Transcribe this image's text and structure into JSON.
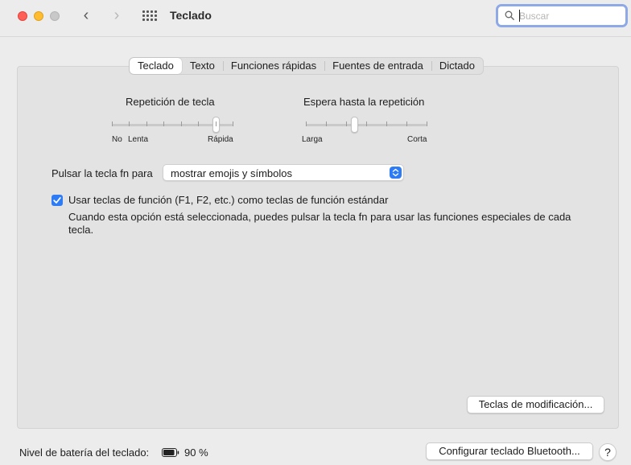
{
  "window": {
    "title": "Teclado",
    "search_placeholder": "Buscar"
  },
  "tabs": [
    {
      "label": "Teclado",
      "active": true
    },
    {
      "label": "Texto",
      "active": false
    },
    {
      "label": "Funciones rápidas",
      "active": false
    },
    {
      "label": "Fuentes de entrada",
      "active": false
    },
    {
      "label": "Dictado",
      "active": false
    }
  ],
  "key_repeat": {
    "label": "Repetición de tecla",
    "min_label": "No",
    "min2_label": "Lenta",
    "max_label": "Rápida",
    "level": 0.857
  },
  "repeat_delay": {
    "label": "Espera hasta la repetición",
    "min_label": "Larga",
    "max_label": "Corta",
    "level": 0.4
  },
  "fn_key": {
    "label": "Pulsar la tecla fn para",
    "selected": "mostrar emojis y símbolos"
  },
  "function_keys_checkbox": {
    "label": "Usar teclas de función (F1, F2, etc.) como teclas de función estándar",
    "checked": true,
    "description": "Cuando esta opción está seleccionada, puedes pulsar la tecla fn para usar las funciones especiales de cada tecla."
  },
  "buttons": {
    "modifier_keys": "Teclas de modificación...",
    "bluetooth": "Configurar teclado Bluetooth...",
    "help": "?"
  },
  "battery": {
    "label": "Nivel de batería del teclado:",
    "value": "90 %",
    "level": 0.9
  },
  "colors": {
    "accent": "#2d7cf6",
    "close": "#ff5f57",
    "minimize": "#febc2e"
  }
}
